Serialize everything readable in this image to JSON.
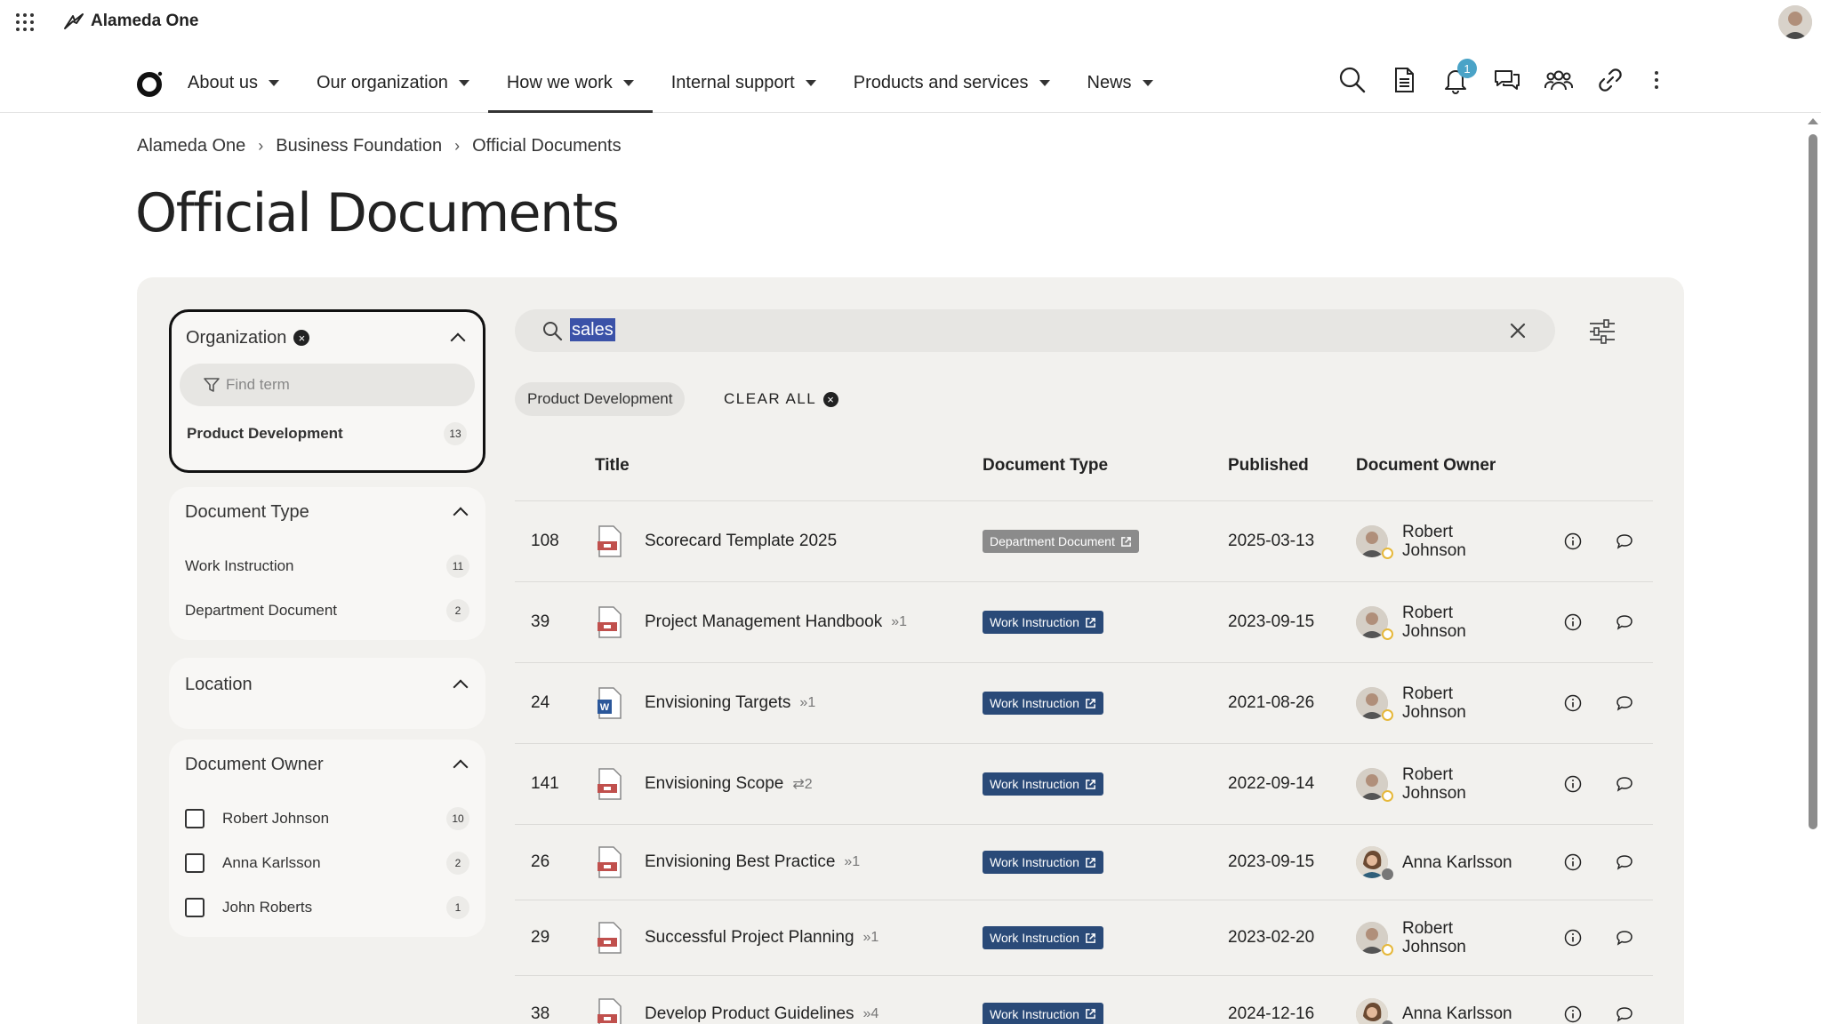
{
  "app": {
    "name": "Alameda One"
  },
  "nav": {
    "items": [
      {
        "label": "About us"
      },
      {
        "label": "Our organization"
      },
      {
        "label": "How we work"
      },
      {
        "label": "Internal support"
      },
      {
        "label": "Products and services"
      },
      {
        "label": "News"
      }
    ],
    "active": "How we work",
    "notification_count": "1"
  },
  "breadcrumb": [
    "Alameda One",
    "Business Foundation",
    "Official Documents"
  ],
  "page_title": "Official Documents",
  "search": {
    "value": "sales"
  },
  "active_filter_chip": "Product Development",
  "clear_all_label": "CLEAR ALL",
  "facets": {
    "organization": {
      "title": "Organization",
      "find_placeholder": "Find term",
      "items": [
        {
          "label": "Product Development",
          "count": "13"
        }
      ]
    },
    "document_type": {
      "title": "Document Type",
      "items": [
        {
          "label": "Work Instruction",
          "count": "11"
        },
        {
          "label": "Department Document",
          "count": "2"
        }
      ]
    },
    "location": {
      "title": "Location"
    },
    "document_owner": {
      "title": "Document Owner",
      "items": [
        {
          "label": "Robert Johnson",
          "count": "10"
        },
        {
          "label": "Anna Karlsson",
          "count": "2"
        },
        {
          "label": "John Roberts",
          "count": "1"
        }
      ]
    }
  },
  "table": {
    "headers": {
      "title": "Title",
      "type": "Document Type",
      "published": "Published",
      "owner": "Document Owner"
    },
    "rows": [
      {
        "id": "108",
        "icon": "pdf-icon",
        "title": "Scorecard Template 2025",
        "rel": "",
        "type": "Department Document",
        "published": "2025-03-13",
        "owner_first": "Robert",
        "owner_last": "Johnson"
      },
      {
        "id": "39",
        "icon": "pdf-icon",
        "title": "Project Management Handbook",
        "rel": "»1",
        "type": "Work Instruction",
        "published": "2023-09-15",
        "owner_first": "Robert",
        "owner_last": "Johnson"
      },
      {
        "id": "24",
        "icon": "word-icon",
        "title": "Envisioning Targets",
        "rel": "»1",
        "type": "Work Instruction",
        "published": "2021-08-26",
        "owner_first": "Robert",
        "owner_last": "Johnson"
      },
      {
        "id": "141",
        "icon": "pdf-icon",
        "title": "Envisioning Scope",
        "rel": "⇄2",
        "type": "Work Instruction",
        "published": "2022-09-14",
        "owner_first": "Robert",
        "owner_last": "Johnson"
      },
      {
        "id": "26",
        "icon": "pdf-icon",
        "title": "Envisioning Best Practice",
        "rel": "»1",
        "type": "Work Instruction",
        "published": "2023-09-15",
        "owner_first": "Anna Karlsson",
        "owner_last": ""
      },
      {
        "id": "29",
        "icon": "pdf-icon",
        "title": "Successful Project Planning",
        "rel": "»1",
        "type": "Work Instruction",
        "published": "2023-02-20",
        "owner_first": "Robert",
        "owner_last": "Johnson"
      },
      {
        "id": "38",
        "icon": "pdf-icon",
        "title": "Develop Product Guidelines",
        "rel": "»4",
        "type": "Work Instruction",
        "published": "2024-12-16",
        "owner_first": "Anna Karlsson",
        "owner_last": ""
      }
    ]
  },
  "colors": {
    "tag_bg": "#2a4a78",
    "tag_dept_bg": "#8b8b8b",
    "panel_bg": "#f2f1ee",
    "badge": "#4aa3c7",
    "selection": "#3b52a8"
  }
}
